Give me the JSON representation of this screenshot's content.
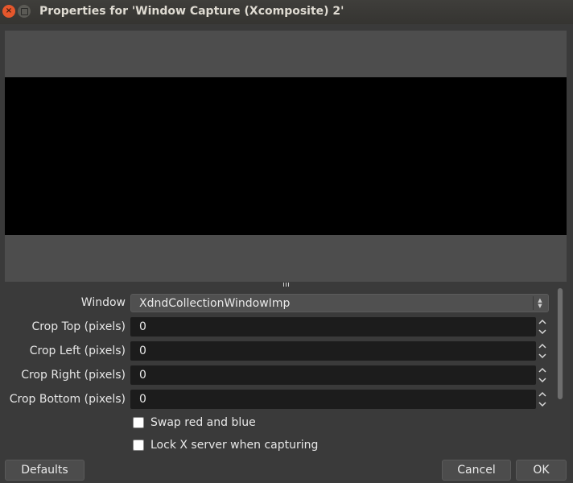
{
  "window": {
    "title": "Properties for 'Window Capture (Xcomposite) 2'",
    "close_glyph": "×"
  },
  "form": {
    "window_label": "Window",
    "window_value": "XdndCollectionWindowImp",
    "crop_top_label": "Crop Top (pixels)",
    "crop_top_value": "0",
    "crop_left_label": "Crop Left (pixels)",
    "crop_left_value": "0",
    "crop_right_label": "Crop Right (pixels)",
    "crop_right_value": "0",
    "crop_bottom_label": "Crop Bottom (pixels)",
    "crop_bottom_value": "0",
    "swap_label": "Swap red and blue",
    "swap_checked": false,
    "lock_label": "Lock X server when capturing",
    "lock_checked": false
  },
  "buttons": {
    "defaults": "Defaults",
    "cancel": "Cancel",
    "ok": "OK"
  },
  "colors": {
    "background": "#3a3a3a",
    "close_button": "#e5572c",
    "preview_bg": "#4d4d4d",
    "field_bg": "#1c1c1c"
  }
}
